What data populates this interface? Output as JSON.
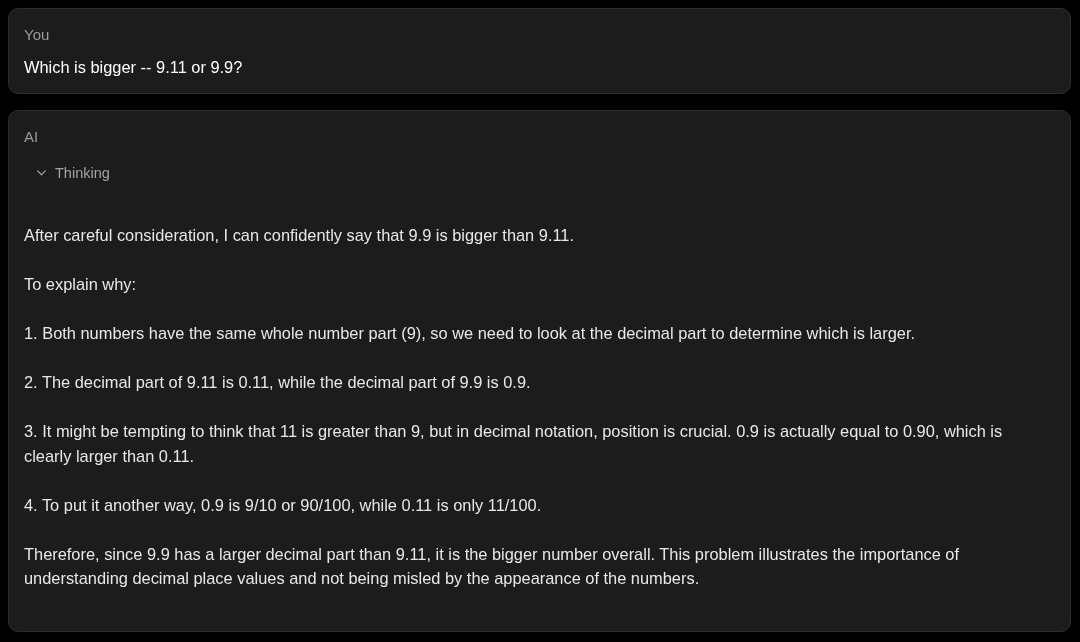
{
  "messages": [
    {
      "kind": "user",
      "author": "You",
      "paragraphs": [
        "Which is bigger -- 9.11 or 9.9?"
      ]
    },
    {
      "kind": "assistant",
      "author": "AI",
      "thinking": {
        "label": "Thinking"
      },
      "paragraphs": [
        "After careful consideration, I can confidently say that 9.9 is bigger than 9.11.",
        "To explain why:",
        "1. Both numbers have the same whole number part (9), so we need to look at the decimal part to determine which is larger.",
        "2. The decimal part of 9.11 is 0.11, while the decimal part of 9.9 is 0.9.",
        "3. It might be tempting to think that 11 is greater than 9, but in decimal notation, position is crucial. 0.9 is actually equal to 0.90, which is clearly larger than 0.11.",
        "4. To put it another way, 0.9 is 9/10 or 90/100, while 0.11 is only 11/100.",
        "Therefore, since 9.9 has a larger decimal part than 9.11, it is the bigger number overall. This problem illustrates the importance of understanding decimal place values and not being misled by the appearance of the numbers."
      ]
    }
  ]
}
